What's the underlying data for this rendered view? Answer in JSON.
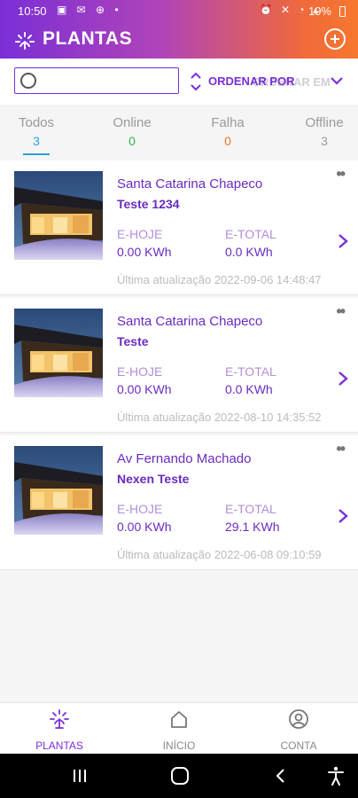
{
  "status_bar": {
    "time": "10:50",
    "battery": "19%"
  },
  "app": {
    "title": "PLANTAS"
  },
  "search": {
    "placeholder": ""
  },
  "sort": {
    "label": "ORDENAR POR",
    "ghost_label": "ORDENAR EM"
  },
  "filters": [
    {
      "label": "Todos",
      "count": "3",
      "color": "#2aa0d8"
    },
    {
      "label": "Online",
      "count": "0",
      "color": "#2fb44a"
    },
    {
      "label": "Falha",
      "count": "0",
      "color": "#f07a2a"
    },
    {
      "label": "Offline",
      "count": "3",
      "color": "#9a9a9a"
    }
  ],
  "plants": [
    {
      "name": "Santa Catarina Chapeco",
      "subtitle": "Teste 1234",
      "e_today_label": "E-HOJE",
      "e_today": "0.00 KWh",
      "e_total_label": "E-TOTAL",
      "e_total": "0.0 KWh",
      "updated": "Última atualização 2022-09-06 14:48:47"
    },
    {
      "name": "Santa Catarina Chapeco",
      "subtitle": "Teste",
      "e_today_label": "E-HOJE",
      "e_today": "0.00 KWh",
      "e_total_label": "E-TOTAL",
      "e_total": "0.0 KWh",
      "updated": "Última atualização 2022-08-10 14:35:52"
    },
    {
      "name": "Av Fernando Machado",
      "subtitle": "Nexen Teste",
      "e_today_label": "E-HOJE",
      "e_today": "0.00 KWh",
      "e_total_label": "E-TOTAL",
      "e_total": "29.1 KWh",
      "updated": "Última atualização 2022-06-08 09:10:59"
    }
  ],
  "bottom_nav": [
    {
      "label": "PLANTAS",
      "icon": "plant-sun-icon",
      "active": true
    },
    {
      "label": "INÍCIO",
      "icon": "home-icon",
      "active": false
    },
    {
      "label": "CONTA",
      "icon": "account-icon",
      "active": false
    }
  ],
  "colors": {
    "accent": "#7a2fd6",
    "header_end": "#f7772f"
  }
}
